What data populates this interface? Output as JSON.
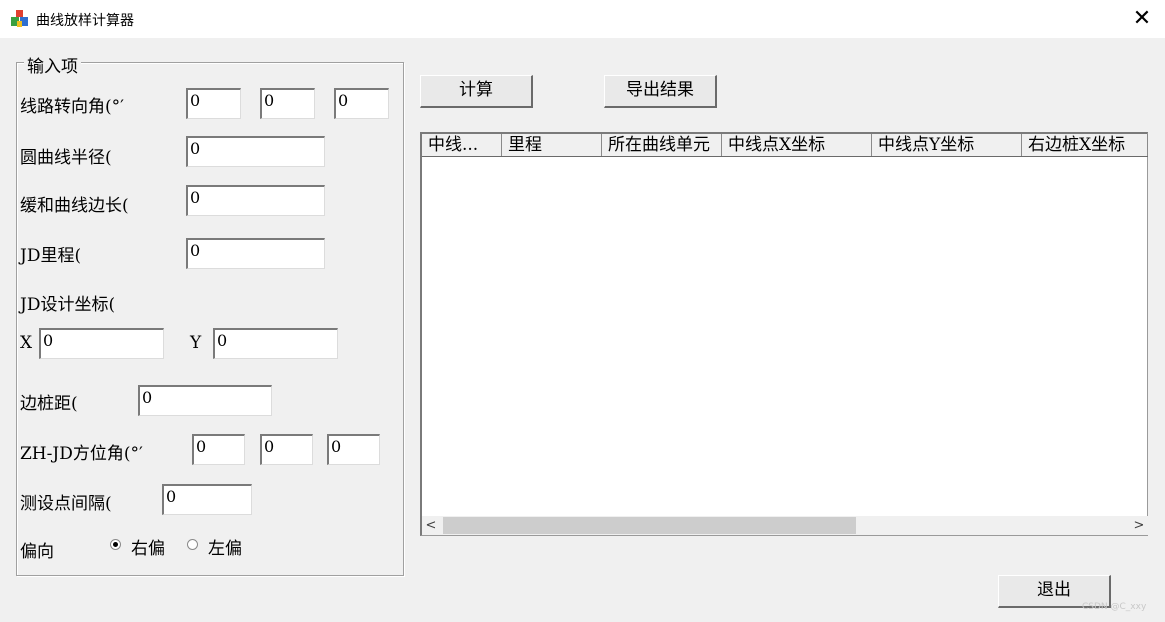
{
  "window": {
    "title": "曲线放样计算器",
    "close_glyph": "✕"
  },
  "group": {
    "title": "输入项"
  },
  "fields": {
    "turn_angle": {
      "label": "线路转向角(°′",
      "values": [
        "0",
        "0",
        "0"
      ]
    },
    "radius": {
      "label": "圆曲线半径(",
      "value": "0"
    },
    "transition_length": {
      "label": "缓和曲线边长(",
      "value": "0"
    },
    "jd_chainage": {
      "label": "JD里程(",
      "value": "0"
    },
    "jd_coords": {
      "label": "JD设计坐标(",
      "x_label": "X",
      "x_value": "0",
      "y_label": "Y",
      "y_value": "0"
    },
    "offset": {
      "label": "边桩距(",
      "value": "0"
    },
    "zh_jd_azimuth": {
      "label": "ZH-JD方位角(°′",
      "values": [
        "0",
        "0",
        "0"
      ]
    },
    "interval": {
      "label": "测设点间隔(",
      "value": "0"
    },
    "side": {
      "label": "偏向",
      "options": [
        "右偏",
        "左偏"
      ],
      "selected": "右偏"
    }
  },
  "buttons": {
    "calculate": "计算",
    "export": "导出结果",
    "exit": "退出"
  },
  "grid": {
    "columns": [
      "中线...",
      "里程",
      "所在曲线单元",
      "中线点X坐标",
      "中线点Y坐标",
      "右边桩X坐标"
    ],
    "rows": []
  },
  "scroll": {
    "left": "<",
    "right": ">"
  },
  "watermark": "CSDN @C_xxy"
}
